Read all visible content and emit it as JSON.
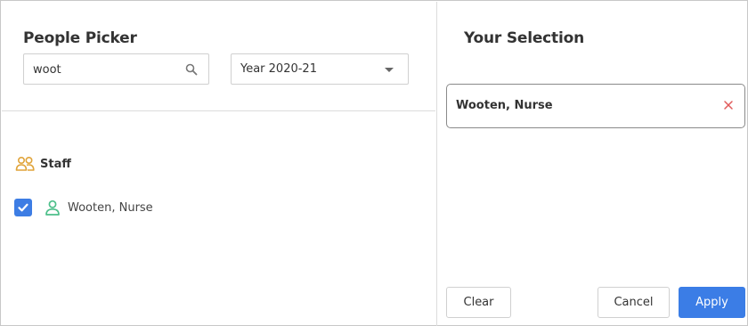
{
  "left_panel": {
    "title": "People Picker",
    "search": {
      "value": "woot",
      "placeholder": ""
    },
    "year_select": {
      "selected": "Year 2020-21"
    },
    "group": {
      "label": "Staff",
      "icon": "group-icon"
    },
    "people": [
      {
        "name": "Wooten, Nurse",
        "checked": true,
        "icon": "person-icon"
      }
    ]
  },
  "right_panel": {
    "title": "Your Selection",
    "selected": [
      {
        "name": "Wooten, Nurse"
      }
    ],
    "buttons": {
      "clear": "Clear",
      "cancel": "Cancel",
      "apply": "Apply"
    }
  },
  "colors": {
    "accent": "#3b7de6",
    "group_icon": "#e0a43a",
    "person_icon": "#4dbf8a",
    "remove_icon": "#e05a5a"
  }
}
